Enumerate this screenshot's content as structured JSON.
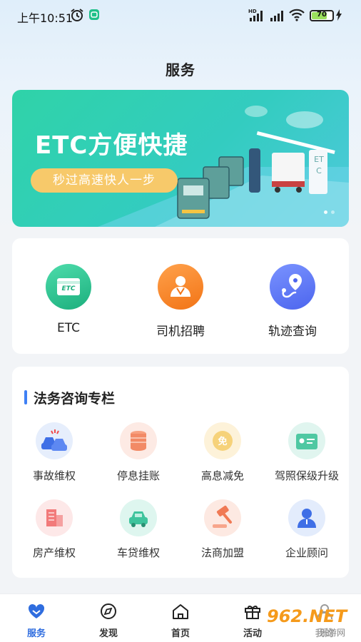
{
  "status_bar": {
    "time": "上午10:51",
    "battery_level": 70,
    "battery_text": "70",
    "hd_label": "HD"
  },
  "page": {
    "title": "服务"
  },
  "banner": {
    "headline": "ETC方便快捷",
    "tagline": "秒过高速快人一步",
    "sign_text": "ETC",
    "slide_count": 2,
    "active_slide": 1
  },
  "quick_actions": [
    {
      "label": "ETC",
      "icon": "etc-card-icon",
      "color": "#22b985",
      "icon_text": "ETC"
    },
    {
      "label": "司机招聘",
      "icon": "driver-recruit-icon",
      "color": "#f57f22"
    },
    {
      "label": "轨迹查询",
      "icon": "track-query-icon",
      "color": "#4f6ef2"
    }
  ],
  "legal": {
    "title": "法务咨询专栏",
    "items": [
      {
        "label": "事故维权",
        "icon": "car-accident-icon"
      },
      {
        "label": "停息挂账",
        "icon": "coin-stack-icon"
      },
      {
        "label": "高息减免",
        "icon": "interest-waiver-icon",
        "icon_text": "免"
      },
      {
        "label": "驾照保级升级",
        "icon": "license-card-icon"
      },
      {
        "label": "房产维权",
        "icon": "building-icon"
      },
      {
        "label": "车贷维权",
        "icon": "car-loan-icon"
      },
      {
        "label": "法商加盟",
        "icon": "gavel-icon"
      },
      {
        "label": "企业顾问",
        "icon": "advisor-icon"
      }
    ]
  },
  "tabbar": {
    "items": [
      {
        "label": "服务",
        "icon": "heart-icon",
        "active": true
      },
      {
        "label": "发现",
        "icon": "compass-icon",
        "active": false
      },
      {
        "label": "首页",
        "icon": "home-icon",
        "active": false
      },
      {
        "label": "活动",
        "icon": "gift-icon",
        "active": false
      },
      {
        "label": "我的",
        "icon": "person-icon",
        "active": false
      }
    ]
  },
  "watermark": {
    "text": "962.NET",
    "subtext": "乐游网"
  },
  "colors": {
    "accent": "#2f6ddf",
    "banner_start": "#2fd3a8",
    "banner_end": "#4fc9dc",
    "pill": "#f7c96a",
    "section_bar": "#3f80f5"
  }
}
